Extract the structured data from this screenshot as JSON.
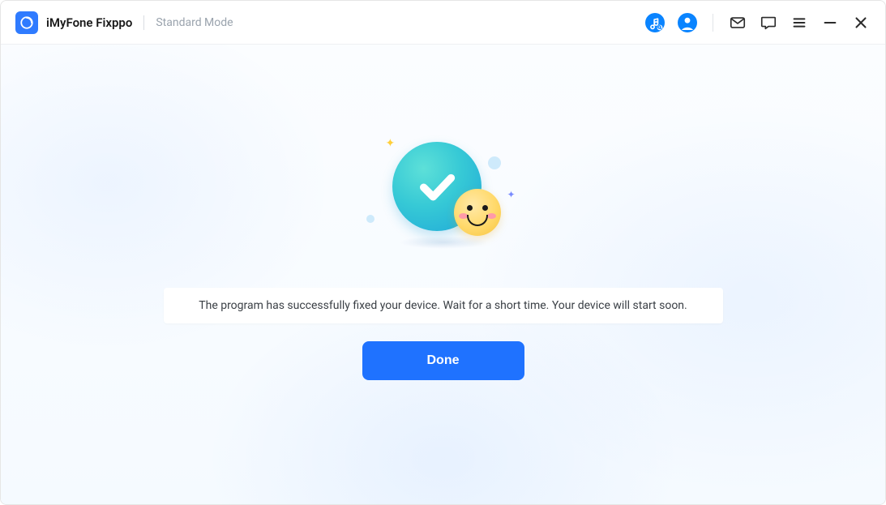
{
  "header": {
    "app_title": "iMyFone Fixppo",
    "mode_label": "Standard Mode"
  },
  "main": {
    "status_message": "The program has successfully fixed your device. Wait for a short time. Your device will start soon.",
    "done_label": "Done"
  },
  "icons": {
    "music": "music-search-icon",
    "account": "account-icon",
    "mail": "mail-icon",
    "chat": "chat-icon",
    "menu": "menu-icon",
    "minimize": "minimize-icon",
    "close": "close-icon"
  },
  "colors": {
    "primary": "#1f72ff",
    "accent_icon": "#0a84ff"
  }
}
